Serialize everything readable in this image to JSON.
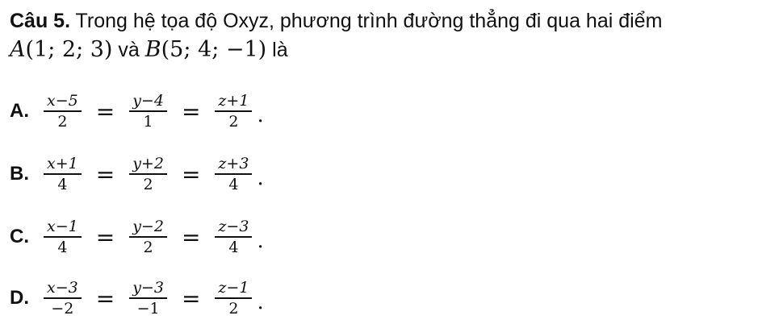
{
  "question": {
    "label": "Câu 5.",
    "text": "Trong hệ tọa độ Oxyz, phương trình đường thẳng đi qua hai điểm",
    "pointA_name": "A",
    "pointA_coords": "(1; 2; 3)",
    "connector": "và",
    "pointB_name": "B",
    "pointB_coords": "(5; 4; −1)",
    "ending": "là"
  },
  "options": [
    {
      "label": "A.",
      "f1_num": "x−5",
      "f1_den": "2",
      "f2_num": "y−4",
      "f2_den": "1",
      "f3_num": "z+1",
      "f3_den": "2"
    },
    {
      "label": "B.",
      "f1_num": "x+1",
      "f1_den": "4",
      "f2_num": "y+2",
      "f2_den": "2",
      "f3_num": "z+3",
      "f3_den": "4"
    },
    {
      "label": "C.",
      "f1_num": "x−1",
      "f1_den": "4",
      "f2_num": "y−2",
      "f2_den": "2",
      "f3_num": "z−3",
      "f3_den": "4"
    },
    {
      "label": "D.",
      "f1_num": "x−3",
      "f1_den": "−2",
      "f2_num": "y−3",
      "f2_den": "−1",
      "f3_num": "z−1",
      "f3_den": "2"
    }
  ],
  "symbols": {
    "equals": "=",
    "period": "."
  }
}
